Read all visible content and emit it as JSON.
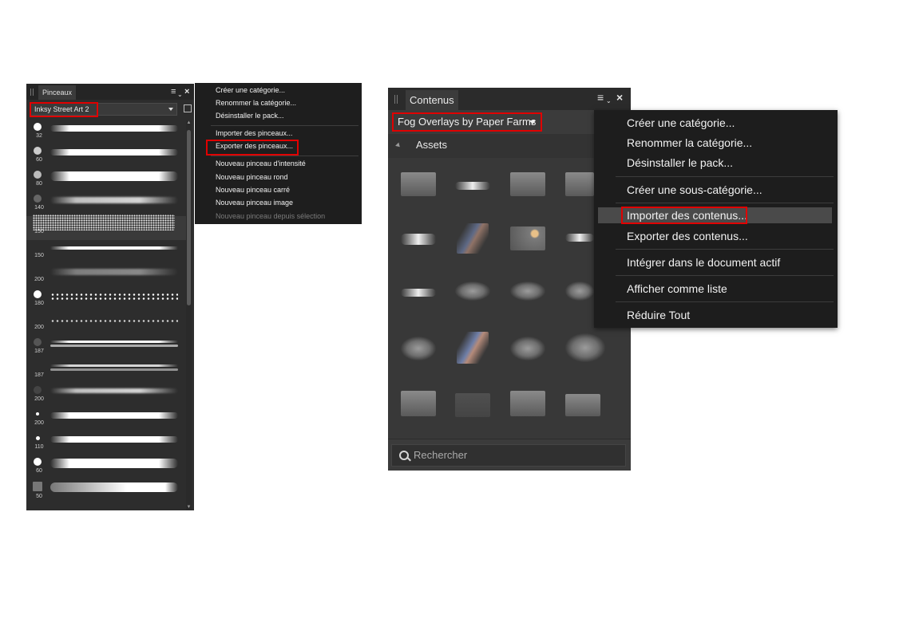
{
  "brushes_panel": {
    "tab_title": "Pinceaux",
    "category": "Inksy Street Art 2",
    "brush_sizes": [
      "32",
      "60",
      "80",
      "140",
      "150",
      "150",
      "200",
      "180",
      "200",
      "187",
      "187",
      "200",
      "200",
      "110",
      "60",
      "50"
    ]
  },
  "brushes_menu": {
    "items": [
      "Créer une catégorie...",
      "Renommer la catégorie...",
      "Désinstaller le pack...",
      "Importer des pinceaux...",
      "Exporter des pinceaux...",
      "Nouveau pinceau d'intensité",
      "Nouveau pinceau rond",
      "Nouveau pinceau carré",
      "Nouveau pinceau image",
      "Nouveau pinceau depuis sélection"
    ]
  },
  "assets_panel": {
    "tab_title": "Contenus",
    "category": "Fog Overlays by Paper Farms",
    "section": "Assets",
    "search_placeholder": "Rechercher"
  },
  "assets_menu": {
    "items": [
      "Créer une catégorie...",
      "Renommer la catégorie...",
      "Désinstaller le pack...",
      "Créer une sous-catégorie...",
      "Importer des contenus...",
      "Exporter des contenus...",
      "Intégrer dans le document actif",
      "Afficher comme liste",
      "Réduire Tout"
    ]
  },
  "colors": {
    "highlight": "#e00000",
    "panel_bg": "#2d2d2d",
    "menu_bg": "#1e1e1e"
  }
}
